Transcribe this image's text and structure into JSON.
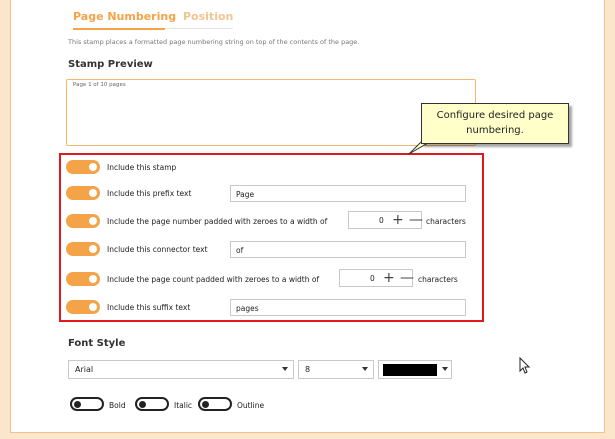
{
  "tabs": [
    {
      "label": "Page Numbering",
      "active": true
    },
    {
      "label": "Position",
      "active": false
    }
  ],
  "description": "This stamp places a formatted page numbering string on top of the contents of the page.",
  "stamp_preview": {
    "heading": "Stamp Preview",
    "text": "Page 1 of 10 pages"
  },
  "callout": {
    "line1": "Configure desired page",
    "line2": "numbering."
  },
  "options": {
    "include_stamp": {
      "label": "Include this stamp",
      "on": true
    },
    "prefix": {
      "label": "Include this prefix text",
      "on": true,
      "value": "Page"
    },
    "page_number": {
      "label": "Include the page number padded with zeroes to a width of",
      "on": true,
      "width": "0",
      "suffix": "characters"
    },
    "connector": {
      "label": "Include this connector text",
      "on": true,
      "value": "of"
    },
    "page_count": {
      "label": "Include the page count padded with zeroes to a width of",
      "on": true,
      "width": "0",
      "suffix": "characters"
    },
    "suffix_text": {
      "label": "Include this suffix text",
      "on": true,
      "value": "pages"
    }
  },
  "font_style": {
    "heading": "Font Style",
    "font": "Arial",
    "size": "8",
    "color": "#000000",
    "bold_label": "Bold",
    "italic_label": "Italic",
    "outline_label": "Outline"
  },
  "colors": {
    "accent": "#f4a349",
    "highlight_border": "#e0191f",
    "callout_bg": "#ffffc9"
  }
}
